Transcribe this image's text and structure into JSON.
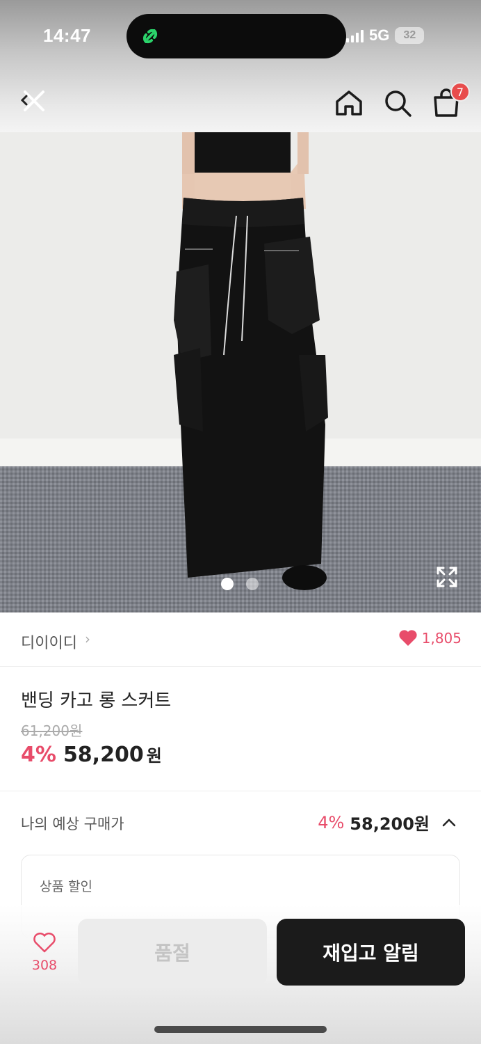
{
  "status_bar": {
    "time": "14:47",
    "network": "5G",
    "battery": "32"
  },
  "nav": {
    "close_icon": "close-icon",
    "home_icon": "home-icon",
    "search_icon": "search-icon",
    "cart_icon": "cart-icon",
    "cart_badge": "7"
  },
  "gallery": {
    "image_count": 2,
    "active_index": 0
  },
  "brand": {
    "name": "디이이디",
    "chevron": "›",
    "likes": "1,805"
  },
  "product": {
    "title": "밴딩 카고 롱 스커트",
    "original_price": "61,200원",
    "discount": "4%",
    "price": "58,200",
    "currency": "원"
  },
  "expected": {
    "label": "나의 예상 구매가",
    "discount": "4%",
    "price": "58,200원"
  },
  "discount_section": {
    "label": "상품 할인"
  },
  "bottom": {
    "wish_count": "308",
    "soldout_label": "품절",
    "restock_label": "재입고 알림"
  },
  "colors": {
    "accent": "#e84c6a",
    "dark_button": "#1b1b1b"
  }
}
